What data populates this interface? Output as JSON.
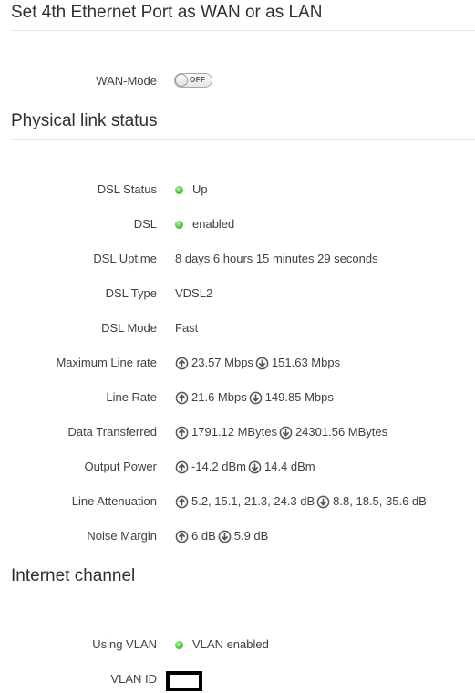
{
  "sections": {
    "wan": {
      "title": "Set 4th Ethernet Port as WAN or as LAN"
    },
    "physical": {
      "title": "Physical link status"
    },
    "internet": {
      "title": "Internet channel"
    }
  },
  "wan_mode": {
    "label": "WAN-Mode",
    "toggle_text": "OFF",
    "state": "off"
  },
  "status": {
    "dsl_status": {
      "label": "DSL Status",
      "value": "Up"
    },
    "dsl": {
      "label": "DSL",
      "value": "enabled"
    },
    "dsl_uptime": {
      "label": "DSL Uptime",
      "value": "8 days 6 hours 15 minutes 29 seconds"
    },
    "dsl_type": {
      "label": "DSL Type",
      "value": "VDSL2"
    },
    "dsl_mode": {
      "label": "DSL Mode",
      "value": "Fast"
    },
    "max_line_rate": {
      "label": "Maximum Line rate",
      "up": "23.57 Mbps",
      "down": "151.63 Mbps"
    },
    "line_rate": {
      "label": "Line Rate",
      "up": "21.6 Mbps",
      "down": "149.85 Mbps"
    },
    "data_transferred": {
      "label": "Data Transferred",
      "up": "1791.12 MBytes",
      "down": "24301.56 MBytes"
    },
    "output_power": {
      "label": "Output Power",
      "up": "-14.2 dBm",
      "down": "14.4 dBm"
    },
    "line_attenuation": {
      "label": "Line Attenuation",
      "up": "5.2, 15.1, 21.3, 24.3 dB",
      "down": "8.8, 18.5, 35.6 dB"
    },
    "noise_margin": {
      "label": "Noise Margin",
      "up": "6 dB",
      "down": "5.9 dB"
    }
  },
  "internet": {
    "using_vlan": {
      "label": "Using VLAN",
      "value": "VLAN enabled"
    },
    "vlan_id": {
      "label": "VLAN ID",
      "value": ""
    }
  },
  "icons": {
    "status_led": "green-led-icon",
    "upstream": "arrow-up-circle-icon",
    "downstream": "arrow-down-circle-icon"
  },
  "colors": {
    "led_green": "#4fc54a",
    "text": "#404040",
    "rule": "#e4e4e4"
  }
}
